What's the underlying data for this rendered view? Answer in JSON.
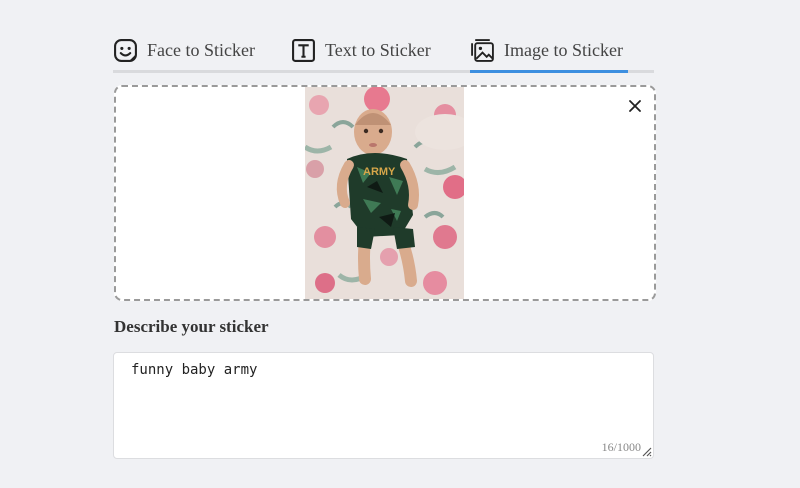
{
  "tabs": [
    {
      "label": "Face to Sticker",
      "icon": "face-sticker-icon",
      "active": false
    },
    {
      "label": "Text to Sticker",
      "icon": "text-box-icon",
      "active": false
    },
    {
      "label": "Image to Sticker",
      "icon": "image-sticker-icon",
      "active": true
    }
  ],
  "upload": {
    "image": "uploaded-photo-baby-on-floral-blanket",
    "close_icon": "close-icon"
  },
  "describe": {
    "label": "Describe your sticker",
    "value": "funny baby army",
    "counter": "16/1000"
  },
  "colors": {
    "accent": "#3d8fe0",
    "background": "#f0f1f4"
  }
}
